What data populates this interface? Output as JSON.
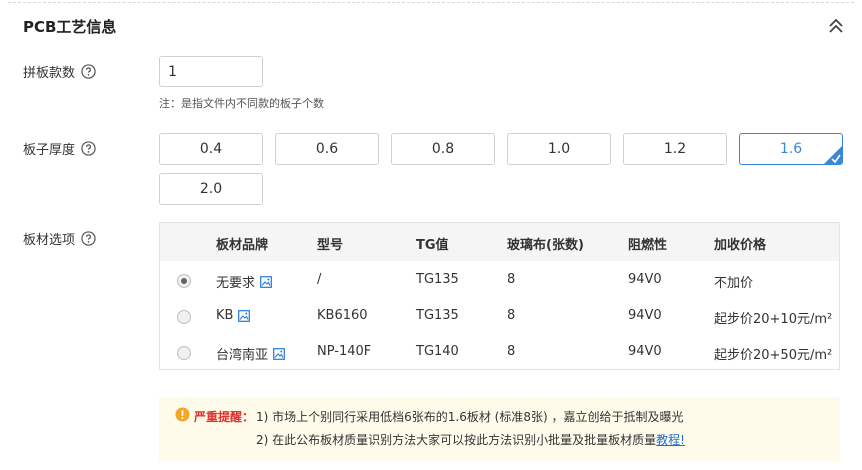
{
  "section": {
    "title": "PCB工艺信息",
    "collapse_icon": "double-chevron-up-icon"
  },
  "quantity": {
    "label": "拼板款数",
    "value": "1",
    "note": "注：是指文件内不同款的板子个数"
  },
  "thickness": {
    "label": "板子厚度",
    "options": [
      "0.4",
      "0.6",
      "0.8",
      "1.0",
      "1.2",
      "1.6",
      "2.0"
    ],
    "selected": "1.6",
    "accent": "#3a87d6"
  },
  "material": {
    "label": "板材选项",
    "headers": [
      "板材品牌",
      "型号",
      "TG值",
      "玻璃布(张数)",
      "阻燃性",
      "加收价格"
    ],
    "rows": [
      {
        "brand": "无要求",
        "model": "/",
        "tg": "TG135",
        "cloth": "8",
        "flame": "94V0",
        "price": "不加价",
        "checked": true
      },
      {
        "brand": "KB",
        "model": "KB6160",
        "tg": "TG135",
        "cloth": "8",
        "flame": "94V0",
        "price": "起步价20+10元/m²",
        "checked": false
      },
      {
        "brand": "台湾南亚",
        "model": "NP-140F",
        "tg": "TG140",
        "cloth": "8",
        "flame": "94V0",
        "price": "起步价20+50元/m²",
        "checked": false
      }
    ]
  },
  "warning": {
    "title": "严重提醒：",
    "line1": "1) 市场上个别同行采用低档6张布的1.6板材 (标准8张) ，嘉立创给于抵制及曝光",
    "line2_text": "2) 在此公布板材质量识别方法大家可以按此方法识别小批量及批量板材质量",
    "line2_link": "教程!",
    "color": "#e0312f"
  }
}
